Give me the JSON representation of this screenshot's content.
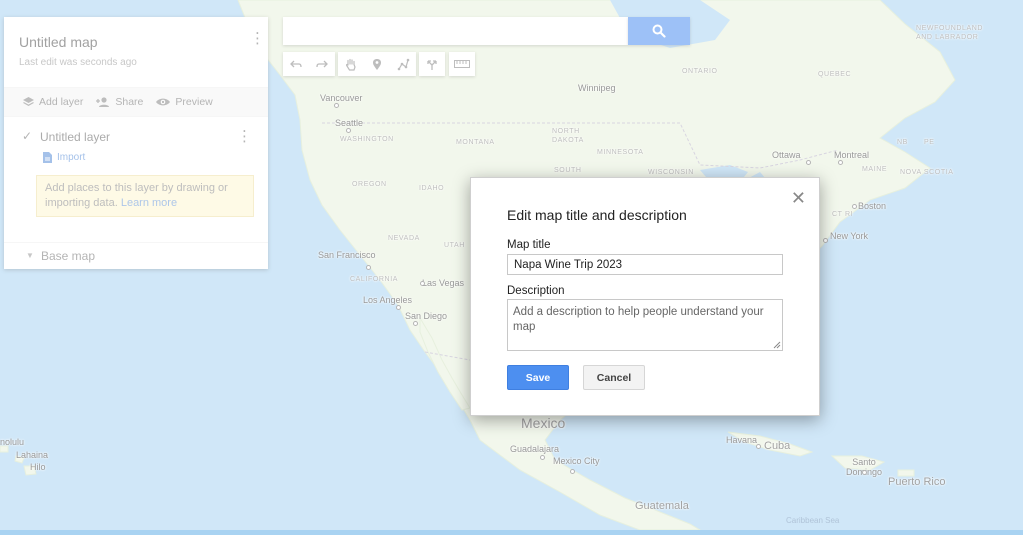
{
  "side_panel": {
    "title": "Untitled map",
    "subtitle": "Last edit was seconds ago",
    "actions": {
      "add_layer": "Add layer",
      "share": "Share",
      "preview": "Preview"
    },
    "layer": {
      "name": "Untitled layer",
      "import_label": "Import",
      "hint_text": "Add places to this layer by drawing or importing data.",
      "hint_link": "Learn more"
    },
    "base_map_label": "Base map"
  },
  "search": {
    "value": "",
    "placeholder": ""
  },
  "map_labels": {
    "newfoundland": "NEWFOUNDLAND\nAND LABRADOR",
    "ontario": "ONTARIO",
    "quebec": "QUEBEC",
    "vancouver": "Vancouver",
    "winnipeg": "Winnipeg",
    "seattle": "Seattle",
    "washington": "WASHINGTON",
    "montana": "MONTANA",
    "north_dakota": "NORTH\nDAKOTA",
    "minnesota": "MINNESOTA",
    "ottawa": "Ottawa",
    "montreal": "Montreal",
    "nb": "NB",
    "pe": "PE",
    "maine": "MAINE",
    "nova_scotia": "NOVA SCOTIA",
    "oregon": "OREGON",
    "idaho": "IDAHO",
    "south": "SOUTH",
    "wisconsin": "WISCONSIN",
    "boston": "Boston",
    "ct_ri": "CT RI",
    "new_york": "New York",
    "nevada": "NEVADA",
    "utah": "UTAH",
    "san_francisco": "San Francisco",
    "california": "CALIFORNIA",
    "las_vegas": "Las Vegas",
    "los_angeles": "Los Angeles",
    "san_diego": "San Diego",
    "mexico": "Mexico",
    "havana": "Havana",
    "cuba": "Cuba",
    "guadalajara": "Guadalajara",
    "mexico_city": "Mexico City",
    "santo_domingo": "Santo\nDomingo",
    "puerto_rico": "Puerto Rico",
    "guatemala": "Guatemala",
    "caribbean_sea": "Caribbean Sea",
    "honolulu": "nolulu",
    "lahaina": "Lahaina",
    "hilo": "Hilo"
  },
  "dialog": {
    "heading": "Edit map title and description",
    "title_label": "Map title",
    "title_value": "Napa Wine Trip 2023",
    "description_label": "Description",
    "description_placeholder": "Add a description to help people understand your map",
    "save_label": "Save",
    "cancel_label": "Cancel",
    "close_glyph": "✕"
  },
  "colors": {
    "water": "#a9d3f2",
    "land": "#e8f1dc",
    "accent": "#4d8ff0"
  }
}
